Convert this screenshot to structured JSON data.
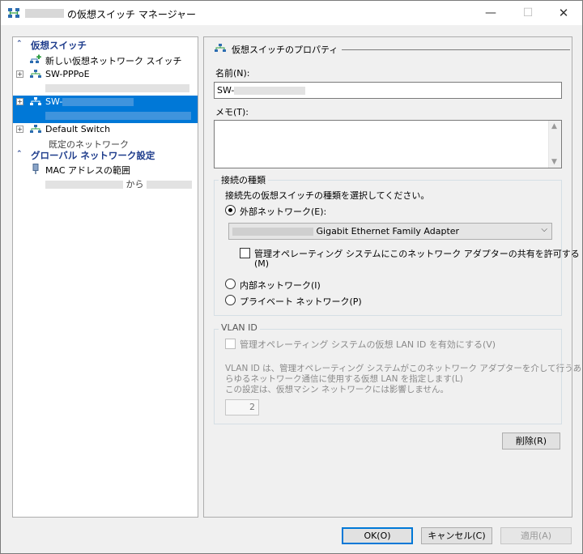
{
  "window": {
    "title": "の仮想スイッチ マネージャー",
    "minimize": "—",
    "maximize": "☐",
    "close": "✕"
  },
  "left": {
    "section_vswitch": "仮想スイッチ",
    "new_switch": "新しい仮想ネットワーク スイッチ",
    "switch1": {
      "name": "SW-PPPoE"
    },
    "switch2": {
      "name_prefix": "SW-"
    },
    "switch3": {
      "name": "Default Switch",
      "sub": "既定のネットワーク"
    },
    "section_global": "グローバル ネットワーク設定",
    "mac_range": {
      "label": "MAC アドレスの範囲",
      "sub_mid": "から"
    }
  },
  "right": {
    "header": "仮想スイッチのプロパティ",
    "name_label": "名前(N):",
    "name_value_prefix": "SW-",
    "memo_label": "メモ(T):",
    "conn_group_title": "接続の種類",
    "conn_desc": "接続先の仮想スイッチの種類を選択してください。",
    "external_label": "外部ネットワーク(E):",
    "adapter_value": "Gigabit Ethernet Family Adapter",
    "share_label_1": "管理オペレーティング システムにこのネットワーク アダプターの共有を許可する",
    "share_label_2": "(M)",
    "internal_label": "内部ネットワーク(I)",
    "private_label": "プライベート ネットワーク(P)",
    "vlan_group_title": "VLAN ID",
    "vlan_enable_label": "管理オペレーティング システムの仮想 LAN ID を有効にする(V)",
    "vlan_desc_1": "VLAN ID は、管理オペレーティング システムがこのネットワーク アダプターを介して行うあ",
    "vlan_desc_2": "らゆるネットワーク通信に使用する仮想 LAN を指定します(L)",
    "vlan_desc_3": "この設定は、仮想マシン ネットワークには影響しません。",
    "vlan_value": "2",
    "delete_button": "削除(R)"
  },
  "footer": {
    "ok": "OK(O)",
    "cancel": "キャンセル(C)",
    "apply": "適用(A)"
  },
  "colors": {
    "selection": "#0078d7",
    "section_header": "#1f3d8c",
    "icon_green": "#2f9e44",
    "icon_blue": "#2b6cb0"
  }
}
